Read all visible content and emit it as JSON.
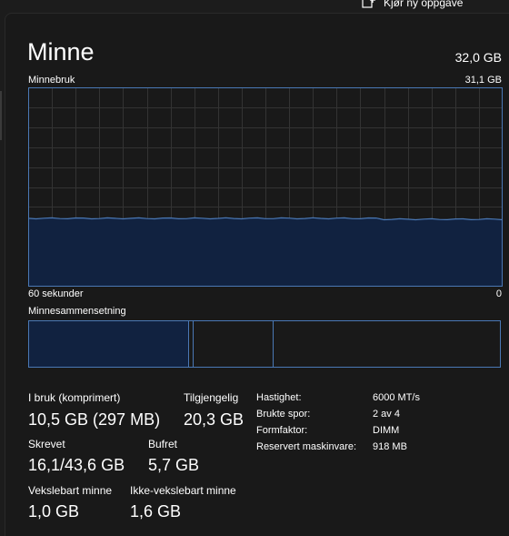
{
  "toolbar": {
    "run_task_label": "Kjør ny oppgave",
    "more_label": "···",
    "run_icon": "new-task-icon"
  },
  "header": {
    "title": "Minne",
    "capacity": "32,0 GB"
  },
  "graph": {
    "label": "Minnebruk",
    "max_label": "31,1 GB",
    "time_label": "60 sekunder",
    "zero_label": "0",
    "usage_fraction": 0.34,
    "line_color": "#4a78b5",
    "fill_color": "#112240",
    "grid_color": "#333333"
  },
  "composition": {
    "label": "Minnesammensetning",
    "in_use_fraction": 0.34,
    "modified_fraction": 0.01,
    "standby_fraction": 0.17,
    "border_color": "#4a78b5",
    "fill_color": "#112240"
  },
  "stats": {
    "in_use": {
      "label": "I bruk (komprimert)",
      "value": "10,5 GB (297 MB)"
    },
    "available": {
      "label": "Tilgjengelig",
      "value": "20,3 GB"
    },
    "committed": {
      "label": "Skrevet",
      "value": "16,1/43,6 GB"
    },
    "cached": {
      "label": "Bufret",
      "value": "5,7 GB"
    },
    "paged_pool": {
      "label": "Vekslebart minne",
      "value": "1,0 GB"
    },
    "nonpaged_pool": {
      "label": "Ikke-vekslebart minne",
      "value": "1,6 GB"
    }
  },
  "details": {
    "speed": {
      "label": "Hastighet:",
      "value": "6000 MT/s"
    },
    "slots": {
      "label": "Brukte spor:",
      "value": "2 av 4"
    },
    "form_factor": {
      "label": "Formfaktor:",
      "value": "DIMM"
    },
    "reserved": {
      "label": "Reservert maskinvare:",
      "value": "918 MB"
    }
  }
}
